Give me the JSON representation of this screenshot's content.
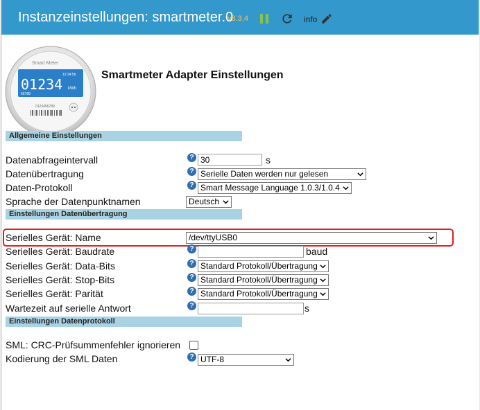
{
  "header": {
    "title": "Instanzeinstellungen: smartmeter.0",
    "version": "v3.3.4",
    "info_label": "info"
  },
  "logo": {
    "brand": "Smart Meter",
    "time": "12:34:56",
    "reading": "01234",
    "unit": "kWh",
    "small_number": "56789",
    "serial": "0123456789"
  },
  "page_title": "Smartmeter Adapter Einstellungen",
  "sections": {
    "general": "Allgemeine Einstellungen",
    "transfer": "Einstellungen Datenübertragung",
    "protocol": "Einstellungen Datenprotokoll"
  },
  "fields": {
    "interval": {
      "label": "Datenabfrageintervall",
      "value": "30",
      "unit": "s"
    },
    "transfer": {
      "label": "Datenübertragung",
      "value": "Serielle Daten werden nur gelesen"
    },
    "protocol": {
      "label": "Daten-Protokoll",
      "value": "Smart Message Language 1.0.3/1.0.4"
    },
    "language": {
      "label": "Sprache der Datenpunktnamen",
      "value": "Deutsch"
    },
    "serial_name": {
      "label": "Serielles Gerät: Name",
      "value": "/dev/ttyUSB0"
    },
    "baudrate": {
      "label": "Serielles Gerät: Baudrate",
      "value": "",
      "unit": "baud"
    },
    "databits": {
      "label": "Serielles Gerät: Data-Bits",
      "value": "Standard Protokoll/Übertragung"
    },
    "stopbits": {
      "label": "Serielles Gerät: Stop-Bits",
      "value": "Standard Protokoll/Übertragung"
    },
    "parity": {
      "label": "Serielles Gerät: Parität",
      "value": "Standard Protokoll/Übertragung"
    },
    "wait": {
      "label": "Wartezeit auf serielle Antwort",
      "value": "",
      "unit": "s"
    },
    "crc": {
      "label": "SML: CRC-Prüfsummenfehler ignorieren",
      "checked": false
    },
    "encoding": {
      "label": "Kodierung der SML Daten",
      "value": "UTF-8"
    }
  },
  "colors": {
    "header": "#3399cc",
    "section": "#a9d3e3",
    "highlight": "#e02020",
    "help": "#2f6fb0"
  }
}
